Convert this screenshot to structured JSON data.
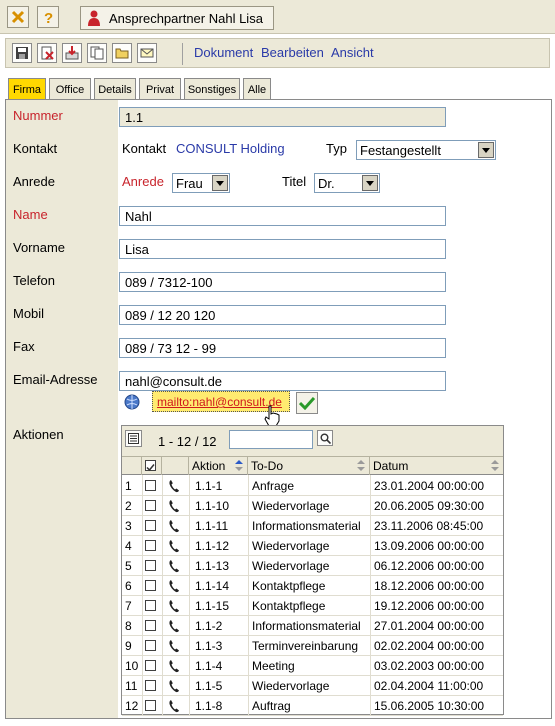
{
  "window": {
    "title": "Ansprechpartner Nahl Lisa"
  },
  "toolbar": {
    "tools": [
      "save-icon",
      "delete-icon",
      "import-icon",
      "copy-icon",
      "open-folder-icon",
      "mail-icon"
    ],
    "menu": [
      "Dokument",
      "Bearbeiten",
      "Ansicht"
    ]
  },
  "tabs": [
    {
      "label": "Firma",
      "active": true
    },
    {
      "label": "Office",
      "active": false
    },
    {
      "label": "Details",
      "active": false
    },
    {
      "label": "Privat",
      "active": false
    },
    {
      "label": "Sonstiges",
      "active": false
    },
    {
      "label": "Alle",
      "active": false
    }
  ],
  "form": {
    "nummer": {
      "label": "Nummer",
      "value": "1.1"
    },
    "kontakt": {
      "label": "Kontakt",
      "sublabel": "Kontakt",
      "value": "CONSULT Holding",
      "typ_label": "Typ",
      "typ_value": "Festangestellt"
    },
    "anrede": {
      "label": "Anrede",
      "sublabel": "Anrede",
      "value": "Frau",
      "titel_label": "Titel",
      "titel_value": "Dr."
    },
    "name": {
      "label": "Name",
      "value": "Nahl"
    },
    "vorname": {
      "label": "Vorname",
      "value": "Lisa"
    },
    "telefon": {
      "label": "Telefon",
      "value": "089 / 7312-100"
    },
    "mobil": {
      "label": "Mobil",
      "value": "089 / 12 20 120"
    },
    "fax": {
      "label": "Fax",
      "value": "089 / 73 12 - 99"
    },
    "email": {
      "label": "Email-Adresse",
      "value": "nahl@consult.de",
      "mailto": "mailto:nahl@consult.de"
    },
    "aktionen": {
      "label": "Aktionen"
    }
  },
  "grid": {
    "range": "1 - 12 / 12",
    "search_value": "",
    "columns": [
      "Aktion",
      "To-Do",
      "Datum"
    ],
    "rows": [
      {
        "n": "1",
        "aktion": "1.1-1",
        "todo": "Anfrage",
        "datum": "23.01.2004 00:00:00"
      },
      {
        "n": "2",
        "aktion": "1.1-10",
        "todo": "Wiedervorlage",
        "datum": "20.06.2005 09:30:00"
      },
      {
        "n": "3",
        "aktion": "1.1-11",
        "todo": "Informationsmaterial",
        "datum": "23.11.2006 08:45:00"
      },
      {
        "n": "4",
        "aktion": "1.1-12",
        "todo": "Wiedervorlage",
        "datum": "13.09.2006 00:00:00"
      },
      {
        "n": "5",
        "aktion": "1.1-13",
        "todo": "Wiedervorlage",
        "datum": "06.12.2006 00:00:00"
      },
      {
        "n": "6",
        "aktion": "1.1-14",
        "todo": "Kontaktpflege",
        "datum": "18.12.2006 00:00:00"
      },
      {
        "n": "7",
        "aktion": "1.1-15",
        "todo": "Kontaktpflege",
        "datum": "19.12.2006 00:00:00"
      },
      {
        "n": "8",
        "aktion": "1.1-2",
        "todo": "Informationsmaterial",
        "datum": "27.01.2004 00:00:00"
      },
      {
        "n": "9",
        "aktion": "1.1-3",
        "todo": "Terminvereinbarung",
        "datum": "02.02.2004 00:00:00"
      },
      {
        "n": "10",
        "aktion": "1.1-4",
        "todo": "Meeting",
        "datum": "03.02.2003 00:00:00"
      },
      {
        "n": "11",
        "aktion": "1.1-5",
        "todo": "Wiedervorlage",
        "datum": "02.04.2004 11:00:00"
      },
      {
        "n": "12",
        "aktion": "1.1-8",
        "todo": "Auftrag",
        "datum": "15.06.2005 10:30:00"
      }
    ]
  }
}
